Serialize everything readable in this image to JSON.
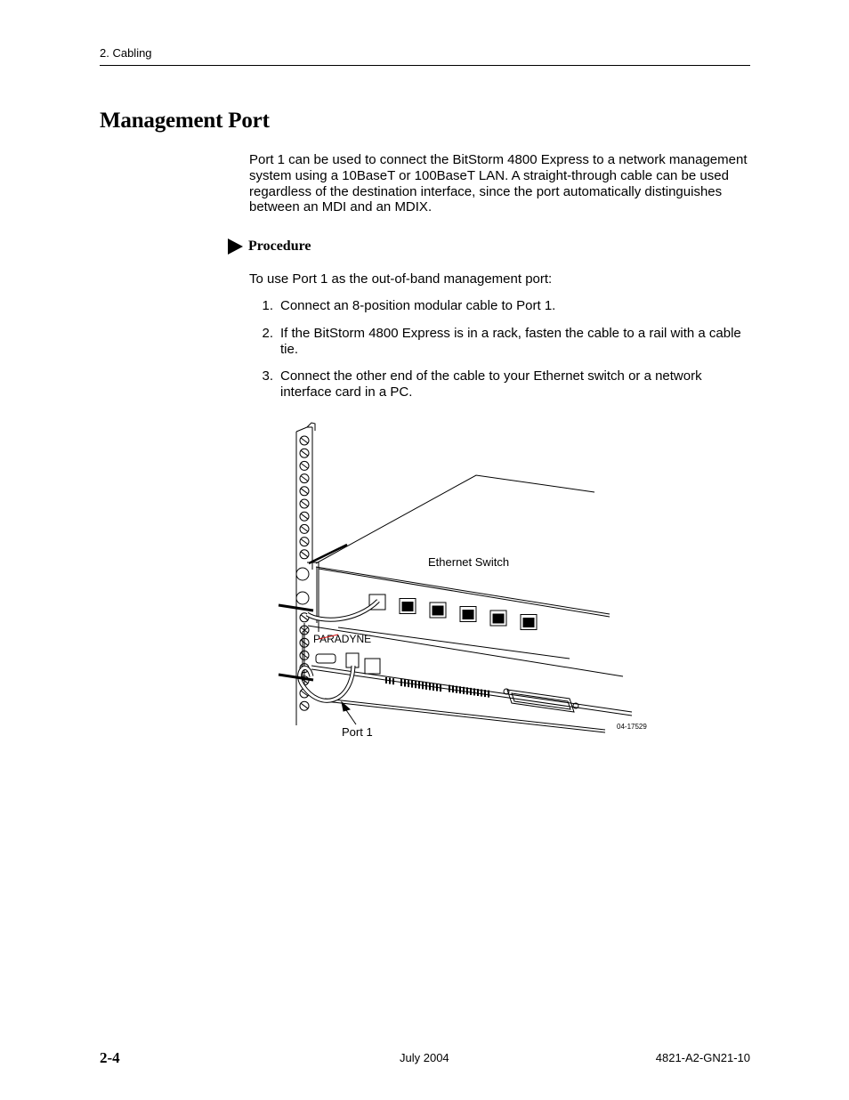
{
  "header": {
    "running_head": "2. Cabling"
  },
  "section": {
    "title": "Management Port",
    "intro": "Port 1 can be used to connect the BitStorm 4800 Express to a network management system using a 10BaseT or 100BaseT LAN. A straight-through cable can be used regardless of the destination interface, since the port automatically distinguishes between an MDI and an MDIX."
  },
  "procedure": {
    "icon": "triangle-right-icon",
    "label": "Procedure",
    "lead": "To use Port 1 as the out-of-band management port:",
    "steps": [
      {
        "num": "1.",
        "text": "Connect an 8-position modular cable to Port 1."
      },
      {
        "num": "2.",
        "text": "If the BitStorm 4800 Express is in a rack, fasten the cable to a rail with a cable tie."
      },
      {
        "num": "3.",
        "text": "Connect the other end of the cable to your Ethernet switch or a network interface card in a PC."
      }
    ]
  },
  "figure": {
    "switch_label": "Ethernet Switch",
    "port_label": "Port 1",
    "brand": "PARADYNE",
    "figure_id": "04-17529",
    "switch_port_count": 6
  },
  "footer": {
    "page_number": "2-4",
    "date": "July 2004",
    "doc_number": "4821-A2-GN21-10"
  }
}
